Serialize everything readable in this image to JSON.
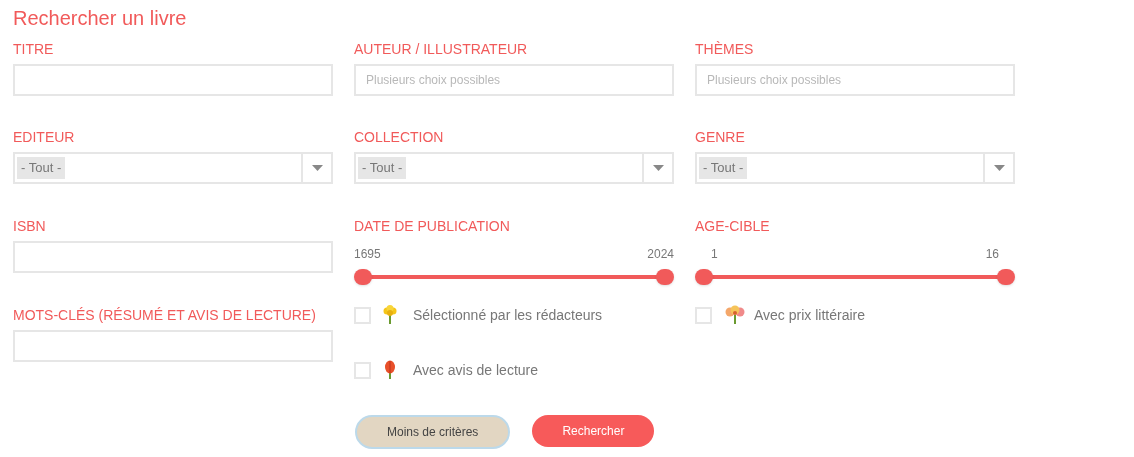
{
  "title": "Rechercher un livre",
  "columns": [
    {
      "fields": [
        {
          "kind": "text",
          "label": "TITRE"
        },
        {
          "kind": "select",
          "label": "EDITEUR",
          "value": "- Tout -"
        },
        {
          "kind": "text",
          "label": "ISBN"
        },
        {
          "kind": "text",
          "label": "MOTS-CLÉS (RÉSUMÉ ET AVIS DE LECTURE)"
        }
      ]
    },
    {
      "fields": [
        {
          "kind": "tags",
          "label": "AUTEUR / ILLUSTRATEUR",
          "placeholder": "Plusieurs choix possibles"
        },
        {
          "kind": "select",
          "label": "COLLECTION",
          "value": "- Tout -"
        },
        {
          "kind": "range",
          "label": "DATE DE PUBLICATION",
          "min": "1695",
          "max": "2024"
        },
        {
          "kind": "checkbox",
          "label": "Sélectionné par les rédacteurs",
          "checked": false
        },
        {
          "kind": "checkbox",
          "label": "Avec avis de lecture",
          "checked": false
        }
      ]
    },
    {
      "fields": [
        {
          "kind": "tags",
          "label": "THÈMES",
          "placeholder": "Plusieurs choix possibles"
        },
        {
          "kind": "select",
          "label": "GENRE",
          "value": "- Tout -"
        },
        {
          "kind": "range",
          "label": "AGE-CIBLE",
          "min": "1",
          "max": "16"
        },
        {
          "kind": "checkbox",
          "label": "Avec prix littéraire",
          "checked": false
        }
      ]
    }
  ],
  "buttons": [
    {
      "label": "Moins de critères",
      "kind": "secondary"
    },
    {
      "label": "Rechercher",
      "kind": "primary"
    }
  ]
}
